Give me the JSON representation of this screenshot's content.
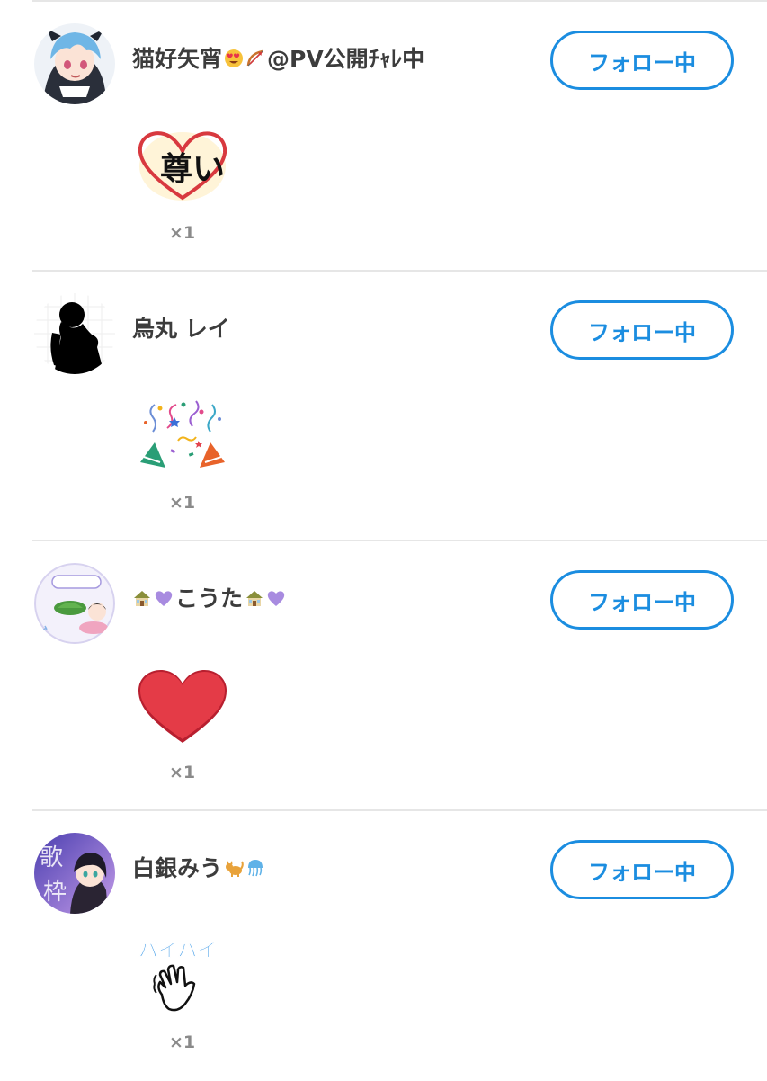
{
  "users": [
    {
      "name": "猫好矢宵",
      "name_suffix": "@PV公開ﾁｬﾚ中",
      "follow_label": "フォロー中",
      "stamp": "toutoi-heart-stamp",
      "stamp_text": "尊い",
      "count": "×1"
    },
    {
      "name": "烏丸 レイ",
      "name_suffix": "",
      "follow_label": "フォロー中",
      "stamp": "party-popper-stamp",
      "count": "×1"
    },
    {
      "name_prefix": "",
      "name": "こうた",
      "name_suffix": "",
      "follow_label": "フォロー中",
      "stamp": "red-heart-stamp",
      "count": "×1"
    },
    {
      "name": "白銀みう",
      "name_suffix": "",
      "follow_label": "フォロー中",
      "stamp": "byebye-wave-stamp",
      "stamp_text": "バイバイ",
      "count": "×1"
    }
  ],
  "colors": {
    "accent": "#1b8de0",
    "divider": "#e6e6e6",
    "name_text": "#3c3c3c",
    "count_text": "#8a8a8a"
  }
}
